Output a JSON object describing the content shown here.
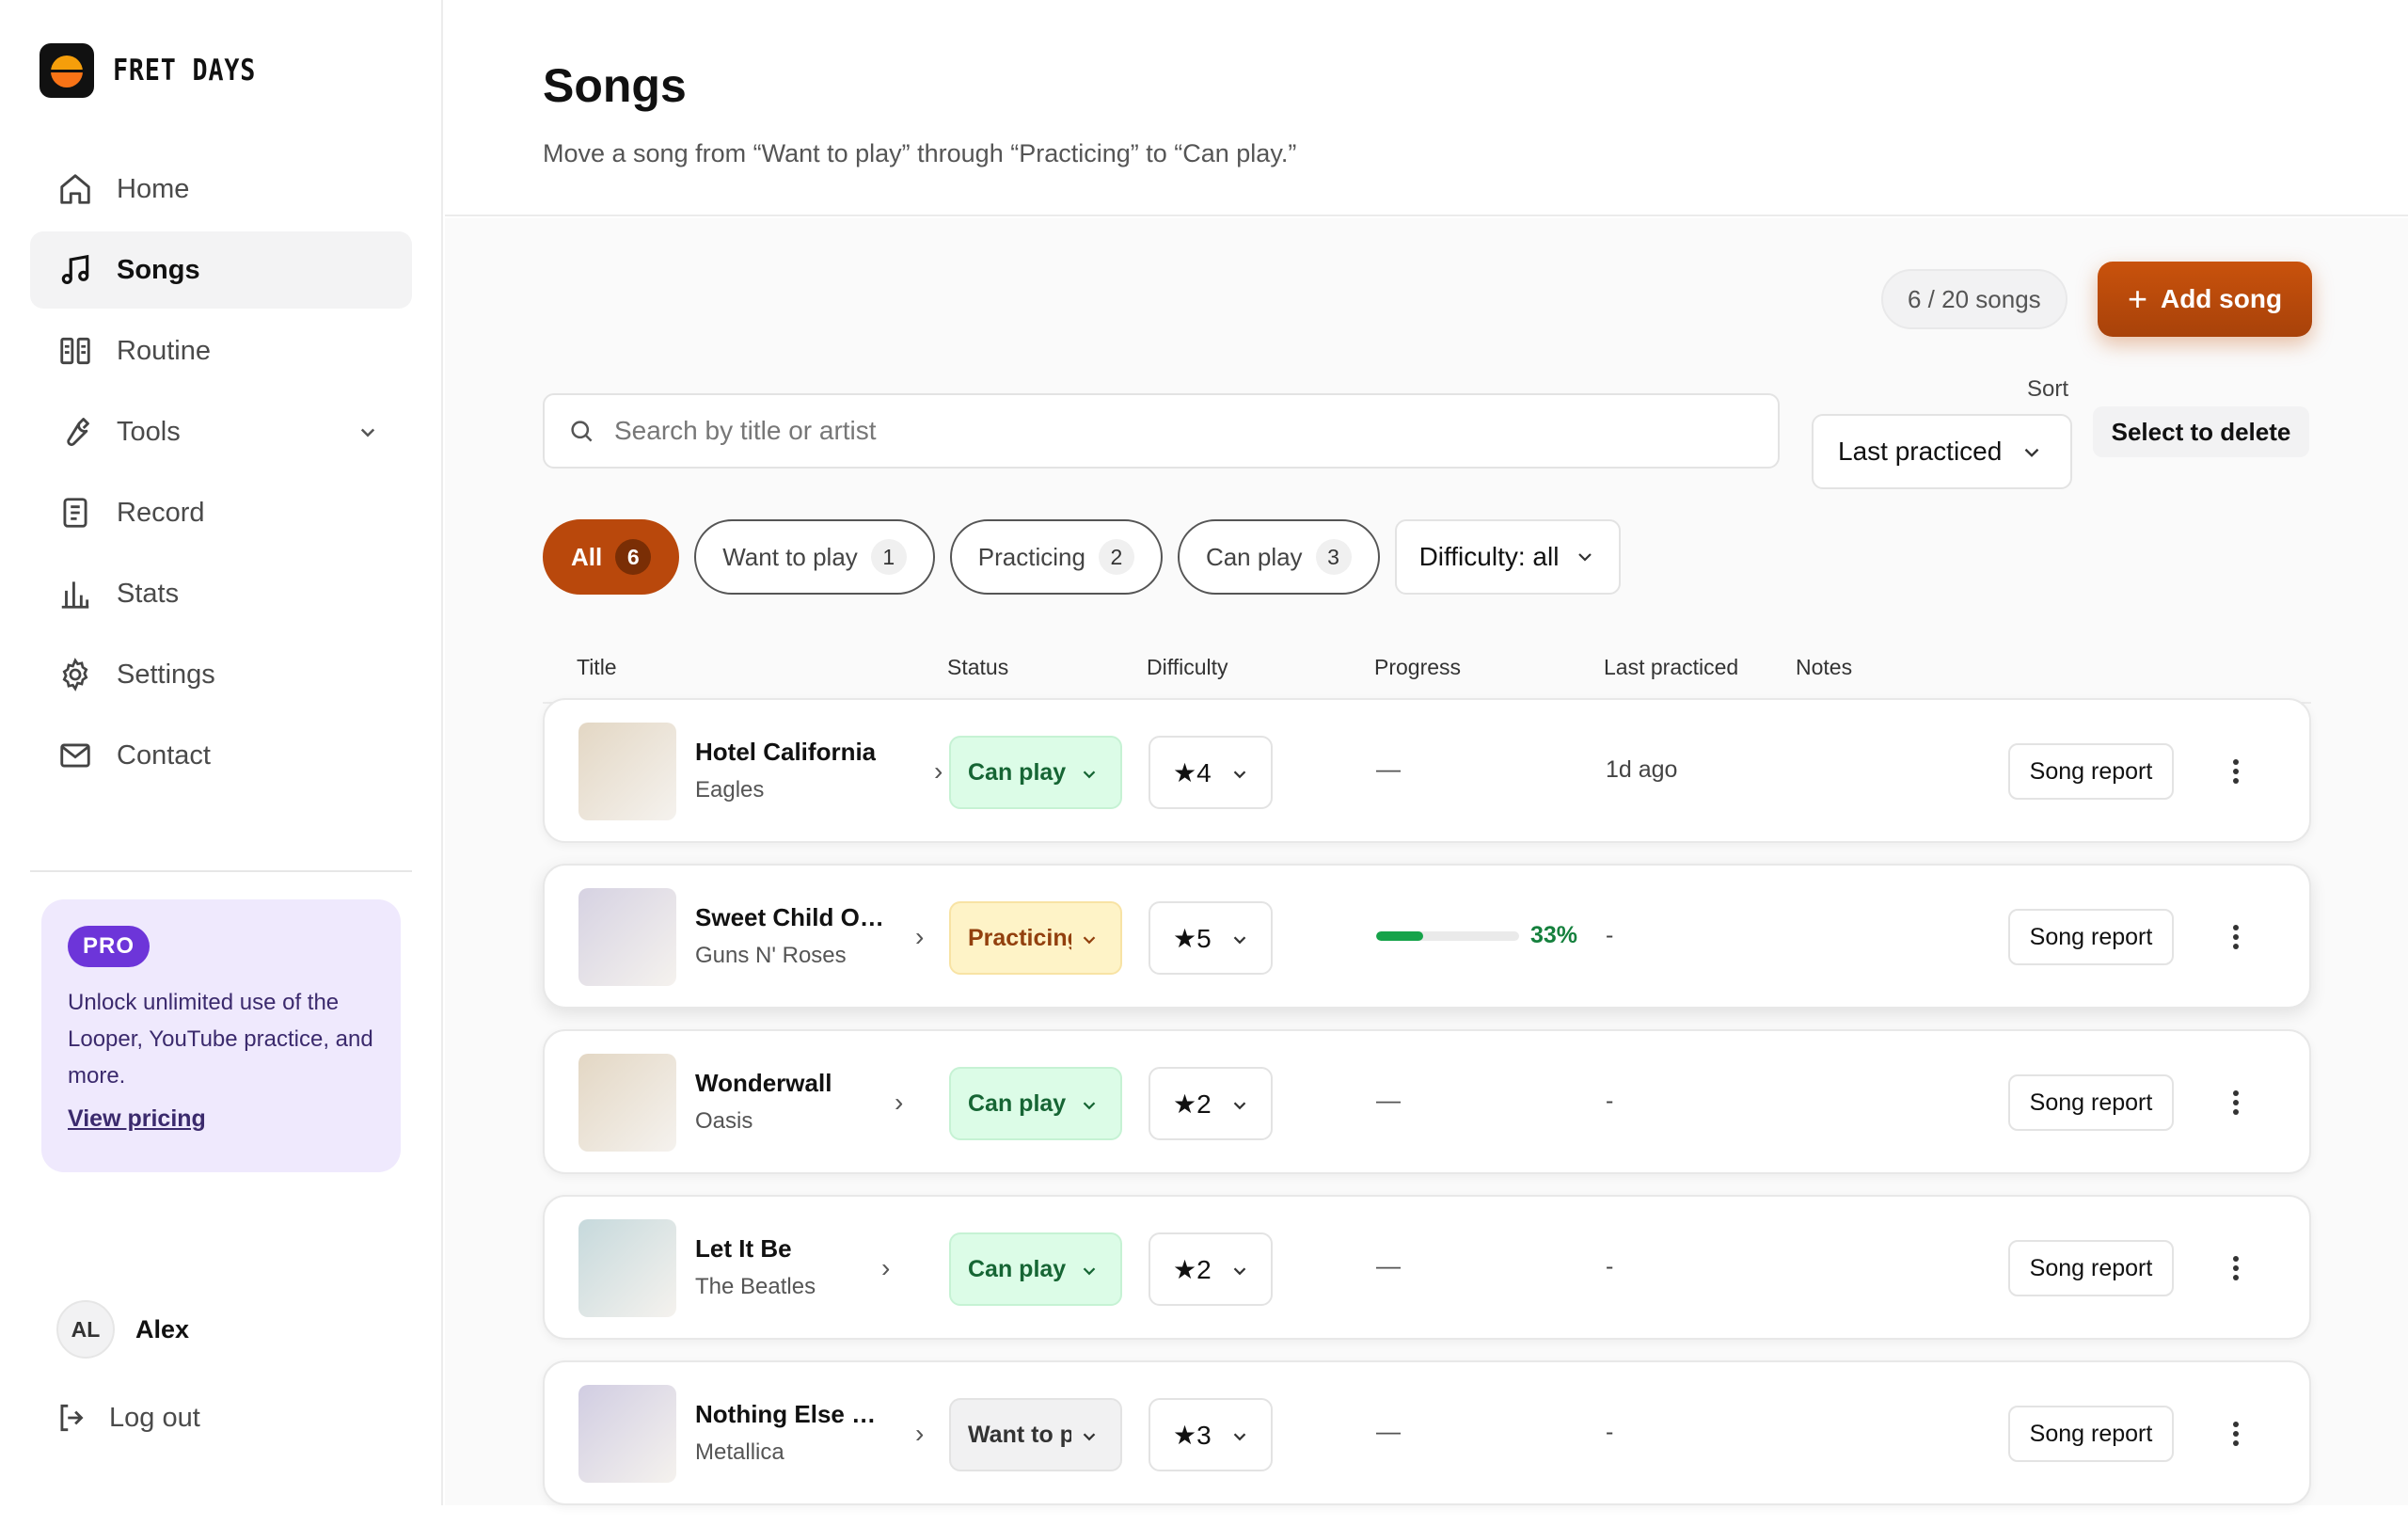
{
  "brand": {
    "name": "FRET DAYS"
  },
  "sidebar": {
    "items": [
      {
        "label": "Home",
        "icon": "home-icon"
      },
      {
        "label": "Songs",
        "icon": "music-note-icon",
        "active": true
      },
      {
        "label": "Routine",
        "icon": "columns-icon"
      },
      {
        "label": "Tools",
        "icon": "wrench-icon",
        "expandable": true
      },
      {
        "label": "Record",
        "icon": "clipboard-icon"
      },
      {
        "label": "Stats",
        "icon": "bar-chart-icon"
      },
      {
        "label": "Settings",
        "icon": "gear-icon"
      },
      {
        "label": "Contact",
        "icon": "mail-icon"
      }
    ],
    "pro": {
      "badge": "PRO",
      "text": "Unlock unlimited use of the Looper, YouTube practice, and more.",
      "link": "View pricing"
    },
    "user": {
      "initials": "AL",
      "name": "Alex"
    },
    "logout": "Log out"
  },
  "header": {
    "title": "Songs",
    "subtitle": "Move a song from “Want to play” through “Practicing” to “Can play.”"
  },
  "toolbar": {
    "count": "6 / 20 songs",
    "add_label": "Add song",
    "search_placeholder": "Search by title or artist",
    "sort_label": "Sort",
    "sort_value": "Last practiced",
    "delete_label": "Select to delete"
  },
  "filters": {
    "chips": [
      {
        "label": "All",
        "count": "6",
        "active": true
      },
      {
        "label": "Want to play",
        "count": "1"
      },
      {
        "label": "Practicing",
        "count": "2"
      },
      {
        "label": "Can play",
        "count": "3"
      }
    ],
    "difficulty": "Difficulty: all"
  },
  "table": {
    "headers": {
      "title": "Title",
      "status": "Status",
      "difficulty": "Difficulty",
      "progress": "Progress",
      "last": "Last practiced",
      "notes": "Notes"
    },
    "rows": [
      {
        "title": "Hotel California",
        "artist": "Eagles",
        "status": "Can play",
        "status_kind": "can",
        "difficulty": "★4",
        "progress": "—",
        "last": "1d ago",
        "report": "Song report",
        "thumb": "#e3d7c4"
      },
      {
        "title": "Sweet Child O' ...",
        "artist": "Guns N' Roses",
        "status": "Practicing",
        "status_kind": "prac",
        "difficulty": "★5",
        "progress_pct": 33,
        "progress_text": "33%",
        "last": "-",
        "report": "Song report",
        "thumb": "#d6d2e2"
      },
      {
        "title": "Wonderwall",
        "artist": "Oasis",
        "status": "Can play",
        "status_kind": "can",
        "difficulty": "★2",
        "progress": "—",
        "last": "-",
        "report": "Song report",
        "thumb": "#e3d7c4"
      },
      {
        "title": "Let It Be",
        "artist": "The Beatles",
        "status": "Can play",
        "status_kind": "can",
        "difficulty": "★2",
        "progress": "—",
        "last": "-",
        "report": "Song report",
        "thumb": "#c6d9dc"
      },
      {
        "title": "Nothing Else Ma...",
        "artist": "Metallica",
        "status": "Want to play",
        "status_kind": "want",
        "difficulty": "★3",
        "progress": "—",
        "last": "-",
        "report": "Song report",
        "thumb": "#d1cde2"
      }
    ]
  },
  "colors": {
    "accent": "#b9480c",
    "pro": "#6d35d9",
    "success": "#16a34a"
  }
}
